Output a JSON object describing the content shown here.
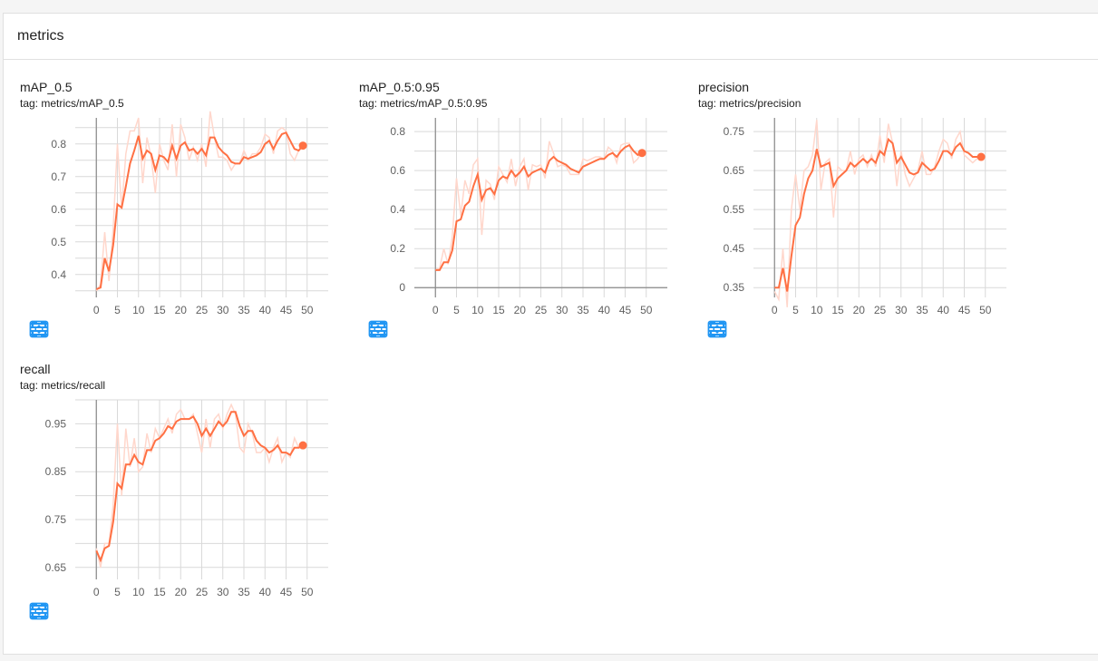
{
  "section": {
    "title": "metrics"
  },
  "colors": {
    "line": "#ff7043",
    "line_raw": "#ffd7cc",
    "grid": "#d9d9d9",
    "axis": "#8a8a8a",
    "icon": "#2196f3"
  },
  "chart_data": [
    {
      "type": "line",
      "title": "mAP_0.5",
      "tag": "tag: metrics/mAP_0.5",
      "xlim": [
        -5,
        55
      ],
      "ylim": [
        0.33,
        0.88
      ],
      "xticks": [
        0,
        5,
        10,
        15,
        20,
        25,
        30,
        35,
        40,
        45,
        50
      ],
      "xtick_labels": [
        "0",
        "5",
        "10",
        "15",
        "20",
        "25",
        "30",
        "35",
        "40",
        "45",
        "50"
      ],
      "yticks": [
        0.4,
        0.5,
        0.6,
        0.7,
        0.8
      ],
      "ytick_labels": [
        "0.4",
        "0.5",
        "0.6",
        "0.7",
        "0.8"
      ],
      "series": [
        {
          "smoothed": true,
          "x": [
            0,
            1,
            2,
            3,
            4,
            5,
            6,
            7,
            8,
            9,
            10,
            11,
            12,
            13,
            14,
            15,
            16,
            17,
            18,
            19,
            20,
            21,
            22,
            23,
            24,
            25,
            26,
            27,
            28,
            29,
            30,
            31,
            32,
            33,
            34,
            35,
            36,
            37,
            38,
            39,
            40,
            41,
            42,
            43,
            44,
            45,
            46,
            47,
            48,
            49
          ],
          "y": [
            0.355,
            0.36,
            0.45,
            0.41,
            0.49,
            0.615,
            0.605,
            0.67,
            0.74,
            0.78,
            0.825,
            0.755,
            0.78,
            0.77,
            0.72,
            0.765,
            0.76,
            0.745,
            0.795,
            0.755,
            0.795,
            0.805,
            0.78,
            0.785,
            0.77,
            0.785,
            0.765,
            0.82,
            0.82,
            0.79,
            0.775,
            0.765,
            0.745,
            0.74,
            0.74,
            0.76,
            0.755,
            0.76,
            0.765,
            0.775,
            0.8,
            0.81,
            0.785,
            0.81,
            0.83,
            0.835,
            0.81,
            0.785,
            0.78,
            0.795
          ]
        },
        {
          "smoothed": false,
          "x": [
            0,
            1,
            2,
            3,
            4,
            5,
            6,
            7,
            8,
            9,
            10,
            11,
            12,
            13,
            14,
            15,
            16,
            17,
            18,
            19,
            20,
            21,
            22,
            23,
            24,
            25,
            26,
            27,
            28,
            29,
            30,
            31,
            32,
            33,
            34,
            35,
            36,
            37,
            38,
            39,
            40,
            41,
            42,
            43,
            44,
            45,
            46,
            47,
            48,
            49
          ],
          "y": [
            0.35,
            0.37,
            0.53,
            0.38,
            0.54,
            0.8,
            0.6,
            0.77,
            0.84,
            0.84,
            0.88,
            0.68,
            0.82,
            0.76,
            0.65,
            0.8,
            0.75,
            0.72,
            0.86,
            0.7,
            0.86,
            0.82,
            0.75,
            0.79,
            0.75,
            0.8,
            0.73,
            0.9,
            0.82,
            0.76,
            0.76,
            0.75,
            0.72,
            0.74,
            0.74,
            0.78,
            0.75,
            0.77,
            0.77,
            0.79,
            0.83,
            0.82,
            0.77,
            0.84,
            0.85,
            0.84,
            0.77,
            0.75,
            0.78,
            0.8
          ]
        }
      ]
    },
    {
      "type": "line",
      "title": "mAP_0.5:0.95",
      "tag": "tag: metrics/mAP_0.5:0.95",
      "xlim": [
        -5,
        55
      ],
      "ylim": [
        -0.05,
        0.87
      ],
      "xticks": [
        0,
        5,
        10,
        15,
        20,
        25,
        30,
        35,
        40,
        45,
        50
      ],
      "xtick_labels": [
        "0",
        "5",
        "10",
        "15",
        "20",
        "25",
        "30",
        "35",
        "40",
        "45",
        "50"
      ],
      "yticks": [
        0,
        0.2,
        0.4,
        0.6,
        0.8
      ],
      "ytick_labels": [
        "0",
        "0.2",
        "0.4",
        "0.6",
        "0.8"
      ],
      "series": [
        {
          "smoothed": true,
          "x": [
            0,
            1,
            2,
            3,
            4,
            5,
            6,
            7,
            8,
            9,
            10,
            11,
            12,
            13,
            14,
            15,
            16,
            17,
            18,
            19,
            20,
            21,
            22,
            23,
            24,
            25,
            26,
            27,
            28,
            29,
            30,
            31,
            32,
            33,
            34,
            35,
            36,
            37,
            38,
            39,
            40,
            41,
            42,
            43,
            44,
            45,
            46,
            47,
            48,
            49
          ],
          "y": [
            0.09,
            0.09,
            0.13,
            0.13,
            0.19,
            0.34,
            0.35,
            0.42,
            0.44,
            0.52,
            0.58,
            0.45,
            0.5,
            0.51,
            0.48,
            0.55,
            0.57,
            0.56,
            0.6,
            0.57,
            0.59,
            0.62,
            0.57,
            0.59,
            0.6,
            0.61,
            0.59,
            0.65,
            0.67,
            0.65,
            0.64,
            0.63,
            0.61,
            0.6,
            0.59,
            0.62,
            0.63,
            0.64,
            0.65,
            0.66,
            0.66,
            0.68,
            0.69,
            0.67,
            0.7,
            0.72,
            0.73,
            0.7,
            0.68,
            0.69
          ]
        },
        {
          "smoothed": false,
          "x": [
            0,
            1,
            2,
            3,
            4,
            5,
            6,
            7,
            8,
            9,
            10,
            11,
            12,
            13,
            14,
            15,
            16,
            17,
            18,
            19,
            20,
            21,
            22,
            23,
            24,
            25,
            26,
            27,
            28,
            29,
            30,
            31,
            32,
            33,
            34,
            35,
            36,
            37,
            38,
            39,
            40,
            41,
            42,
            43,
            44,
            45,
            46,
            47,
            48,
            49
          ],
          "y": [
            0.09,
            0.1,
            0.2,
            0.12,
            0.26,
            0.56,
            0.37,
            0.55,
            0.48,
            0.63,
            0.66,
            0.27,
            0.55,
            0.53,
            0.45,
            0.62,
            0.58,
            0.54,
            0.66,
            0.52,
            0.62,
            0.66,
            0.5,
            0.63,
            0.62,
            0.63,
            0.56,
            0.75,
            0.69,
            0.62,
            0.63,
            0.62,
            0.58,
            0.58,
            0.58,
            0.66,
            0.65,
            0.66,
            0.67,
            0.67,
            0.66,
            0.72,
            0.7,
            0.64,
            0.73,
            0.74,
            0.74,
            0.64,
            0.66,
            0.7
          ]
        }
      ]
    },
    {
      "type": "line",
      "title": "precision",
      "tag": "tag: metrics/precision",
      "xlim": [
        -5,
        55
      ],
      "ylim": [
        0.325,
        0.785
      ],
      "xticks": [
        0,
        5,
        10,
        15,
        20,
        25,
        30,
        35,
        40,
        45,
        50
      ],
      "xtick_labels": [
        "0",
        "5",
        "10",
        "15",
        "20",
        "25",
        "30",
        "35",
        "40",
        "45",
        "50"
      ],
      "yticks": [
        0.35,
        0.45,
        0.55,
        0.65,
        0.75
      ],
      "ytick_labels": [
        "0.35",
        "0.45",
        "0.55",
        "0.65",
        "0.75"
      ],
      "series": [
        {
          "smoothed": true,
          "x": [
            0,
            1,
            2,
            3,
            4,
            5,
            6,
            7,
            8,
            9,
            10,
            11,
            12,
            13,
            14,
            15,
            16,
            17,
            18,
            19,
            20,
            21,
            22,
            23,
            24,
            25,
            26,
            27,
            28,
            29,
            30,
            31,
            32,
            33,
            34,
            35,
            36,
            37,
            38,
            39,
            40,
            41,
            42,
            43,
            44,
            45,
            46,
            47,
            48,
            49
          ],
          "y": [
            0.35,
            0.35,
            0.4,
            0.34,
            0.43,
            0.51,
            0.53,
            0.59,
            0.63,
            0.65,
            0.705,
            0.66,
            0.665,
            0.67,
            0.61,
            0.63,
            0.64,
            0.65,
            0.67,
            0.66,
            0.67,
            0.68,
            0.67,
            0.68,
            0.67,
            0.7,
            0.69,
            0.73,
            0.72,
            0.67,
            0.685,
            0.665,
            0.645,
            0.64,
            0.645,
            0.67,
            0.66,
            0.65,
            0.655,
            0.675,
            0.7,
            0.7,
            0.69,
            0.71,
            0.72,
            0.7,
            0.695,
            0.685,
            0.685,
            0.685
          ]
        },
        {
          "smoothed": false,
          "x": [
            0,
            1,
            2,
            3,
            4,
            5,
            6,
            7,
            8,
            9,
            10,
            11,
            12,
            13,
            14,
            15,
            16,
            17,
            18,
            19,
            20,
            21,
            22,
            23,
            24,
            25,
            26,
            27,
            28,
            29,
            30,
            31,
            32,
            33,
            34,
            35,
            36,
            37,
            38,
            39,
            40,
            41,
            42,
            43,
            44,
            45,
            46,
            47,
            48,
            49
          ],
          "y": [
            0.34,
            0.32,
            0.45,
            0.3,
            0.55,
            0.64,
            0.55,
            0.65,
            0.66,
            0.69,
            0.78,
            0.6,
            0.67,
            0.68,
            0.53,
            0.66,
            0.65,
            0.65,
            0.7,
            0.64,
            0.68,
            0.69,
            0.66,
            0.69,
            0.66,
            0.74,
            0.67,
            0.77,
            0.72,
            0.61,
            0.7,
            0.64,
            0.61,
            0.63,
            0.65,
            0.7,
            0.64,
            0.64,
            0.66,
            0.7,
            0.73,
            0.72,
            0.68,
            0.73,
            0.75,
            0.69,
            0.68,
            0.67,
            0.68,
            0.69
          ]
        }
      ]
    },
    {
      "type": "line",
      "title": "recall",
      "tag": "tag: metrics/recall",
      "xlim": [
        -5,
        55
      ],
      "ylim": [
        0.625,
        1.0
      ],
      "xticks": [
        0,
        5,
        10,
        15,
        20,
        25,
        30,
        35,
        40,
        45,
        50
      ],
      "xtick_labels": [
        "0",
        "5",
        "10",
        "15",
        "20",
        "25",
        "30",
        "35",
        "40",
        "45",
        "50"
      ],
      "yticks": [
        0.65,
        0.75,
        0.85,
        0.95
      ],
      "ytick_labels": [
        "0.65",
        "0.75",
        "0.85",
        "0.95"
      ],
      "series": [
        {
          "smoothed": true,
          "x": [
            0,
            1,
            2,
            3,
            4,
            5,
            6,
            7,
            8,
            9,
            10,
            11,
            12,
            13,
            14,
            15,
            16,
            17,
            18,
            19,
            20,
            21,
            22,
            23,
            24,
            25,
            26,
            27,
            28,
            29,
            30,
            31,
            32,
            33,
            34,
            35,
            36,
            37,
            38,
            39,
            40,
            41,
            42,
            43,
            44,
            45,
            46,
            47,
            48,
            49
          ],
          "y": [
            0.685,
            0.665,
            0.69,
            0.695,
            0.745,
            0.825,
            0.815,
            0.865,
            0.865,
            0.885,
            0.87,
            0.865,
            0.895,
            0.895,
            0.915,
            0.92,
            0.93,
            0.945,
            0.94,
            0.955,
            0.96,
            0.96,
            0.96,
            0.965,
            0.95,
            0.925,
            0.94,
            0.925,
            0.94,
            0.955,
            0.945,
            0.955,
            0.975,
            0.975,
            0.945,
            0.925,
            0.935,
            0.935,
            0.915,
            0.905,
            0.9,
            0.89,
            0.895,
            0.905,
            0.89,
            0.89,
            0.885,
            0.9,
            0.9,
            0.905
          ]
        },
        {
          "smoothed": false,
          "x": [
            0,
            1,
            2,
            3,
            4,
            5,
            6,
            7,
            8,
            9,
            10,
            11,
            12,
            13,
            14,
            15,
            16,
            17,
            18,
            19,
            20,
            21,
            22,
            23,
            24,
            25,
            26,
            27,
            28,
            29,
            30,
            31,
            32,
            33,
            34,
            35,
            36,
            37,
            38,
            39,
            40,
            41,
            42,
            43,
            44,
            45,
            46,
            47,
            48,
            49
          ],
          "y": [
            0.69,
            0.65,
            0.7,
            0.7,
            0.78,
            0.95,
            0.8,
            0.94,
            0.86,
            0.92,
            0.85,
            0.86,
            0.93,
            0.89,
            0.94,
            0.92,
            0.94,
            0.96,
            0.93,
            0.97,
            0.98,
            0.96,
            0.96,
            0.97,
            0.93,
            0.89,
            0.96,
            0.9,
            0.96,
            0.97,
            0.94,
            0.97,
            0.99,
            0.97,
            0.9,
            0.89,
            0.95,
            0.93,
            0.89,
            0.89,
            0.9,
            0.87,
            0.9,
            0.92,
            0.87,
            0.89,
            0.88,
            0.92,
            0.9,
            0.91
          ]
        }
      ]
    }
  ]
}
